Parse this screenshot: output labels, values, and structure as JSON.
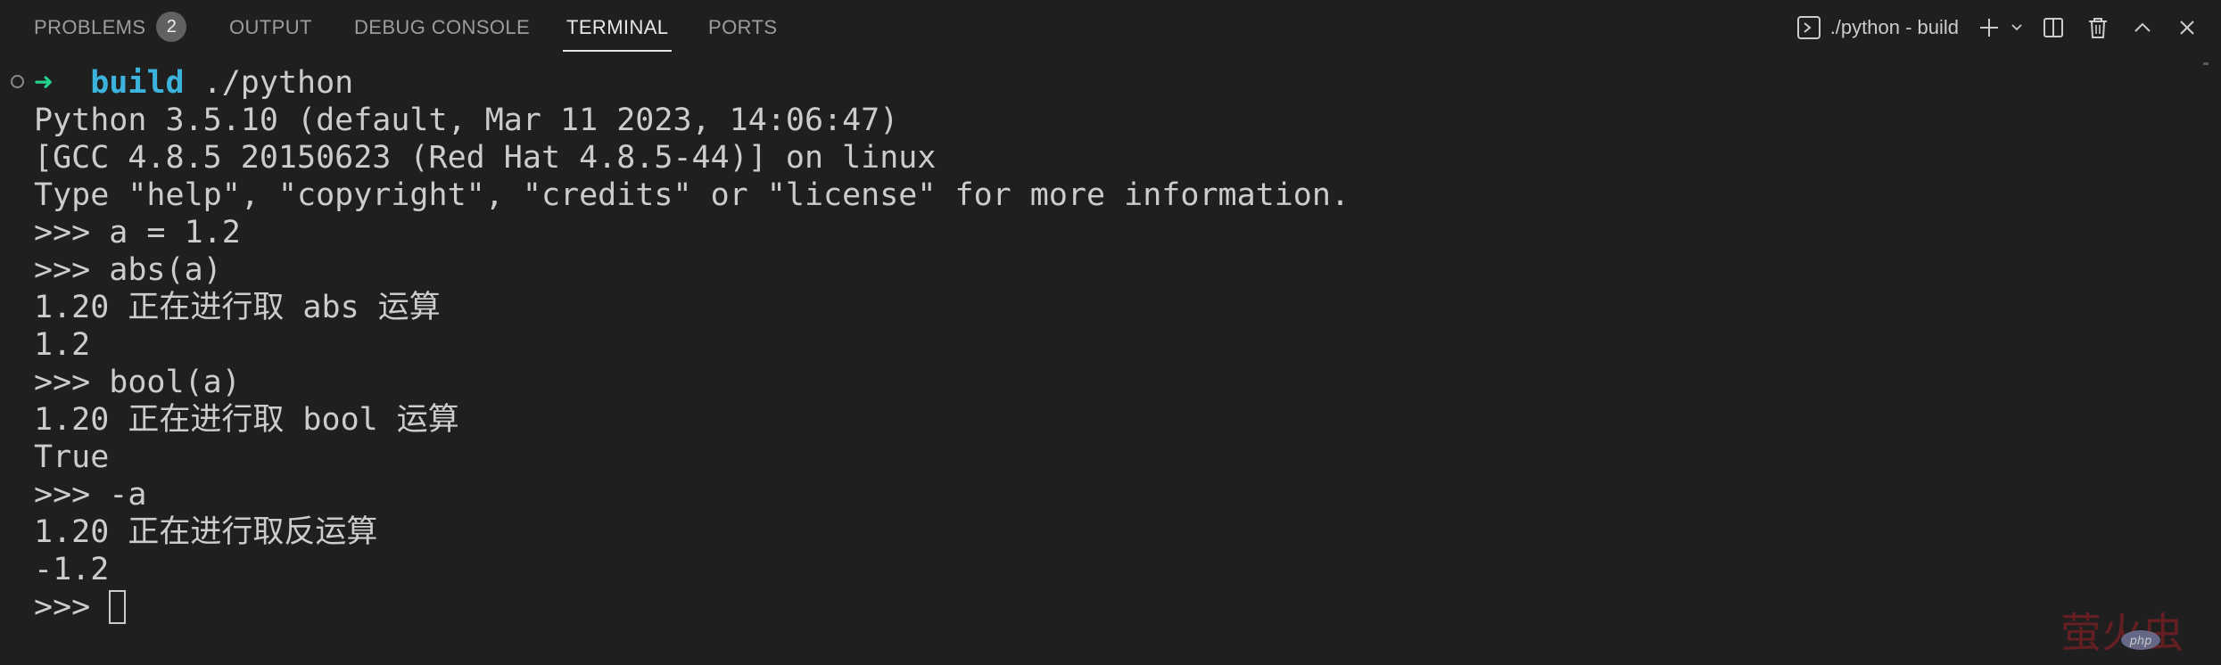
{
  "tabs": [
    {
      "label": "PROBLEMS",
      "badge": "2"
    },
    {
      "label": "OUTPUT"
    },
    {
      "label": "DEBUG CONSOLE"
    },
    {
      "label": "TERMINAL",
      "active": true
    },
    {
      "label": "PORTS"
    }
  ],
  "toolbar": {
    "terminal_name": "./python - build",
    "icons": [
      "terminal-icon",
      "plus-icon",
      "chevron-down-icon",
      "split-icon",
      "trash-icon",
      "chevron-up-icon",
      "close-icon"
    ]
  },
  "terminal": {
    "prompt_arrow": "➜",
    "prompt_dir": "build",
    "prompt_cmd": " ./python",
    "lines": [
      "Python 3.5.10 (default, Mar 11 2023, 14:06:47)",
      "[GCC 4.8.5 20150623 (Red Hat 4.8.5-44)] on linux",
      "Type \"help\", \"copyright\", \"credits\" or \"license\" for more information.",
      ">>> a = 1.2",
      ">>> abs(a)",
      "1.20 正在进行取 abs 运算",
      "1.2",
      ">>> bool(a)",
      "1.20 正在进行取 bool 运算",
      "True",
      ">>> -a",
      "1.20 正在进行取反运算",
      "-1.2"
    ],
    "current_prompt": ">>> "
  },
  "watermark": {
    "text": "萤火虫",
    "sub": "php"
  },
  "colors": {
    "background": "#1f1f1f",
    "text": "#cccccc",
    "prompt_arrow": "#23d18b",
    "prompt_dir": "#3bb3dd",
    "watermark": "#c8202a"
  }
}
